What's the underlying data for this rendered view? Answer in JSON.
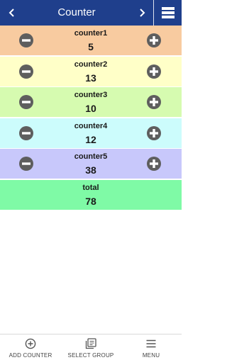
{
  "header": {
    "title": "Counter",
    "bg_color": "#1f3f8c",
    "prev_icon": "chevron-left-icon",
    "next_icon": "chevron-right-icon",
    "menu_icon": "list-menu-icon"
  },
  "counters": [
    {
      "name": "counter1",
      "value": "5",
      "color": "#f8cba0"
    },
    {
      "name": "counter2",
      "value": "13",
      "color": "#ffffc8"
    },
    {
      "name": "counter3",
      "value": "10",
      "color": "#d6fbb0"
    },
    {
      "name": "counter4",
      "value": "12",
      "color": "#ccfcfc"
    },
    {
      "name": "counter5",
      "value": "38",
      "color": "#c8c8fb"
    }
  ],
  "total": {
    "name": "total",
    "value": "78",
    "color": "#7ffaa6"
  },
  "icons": {
    "decrement": "minus-circle-icon",
    "increment": "plus-circle-icon",
    "icon_color": "#5e5e5e"
  },
  "bottom_nav": [
    {
      "label": "ADD COUNTER",
      "icon": "add-circle-icon"
    },
    {
      "label": "SELECT GROUP",
      "icon": "collection-icon"
    },
    {
      "label": "MENU",
      "icon": "hamburger-icon"
    }
  ]
}
